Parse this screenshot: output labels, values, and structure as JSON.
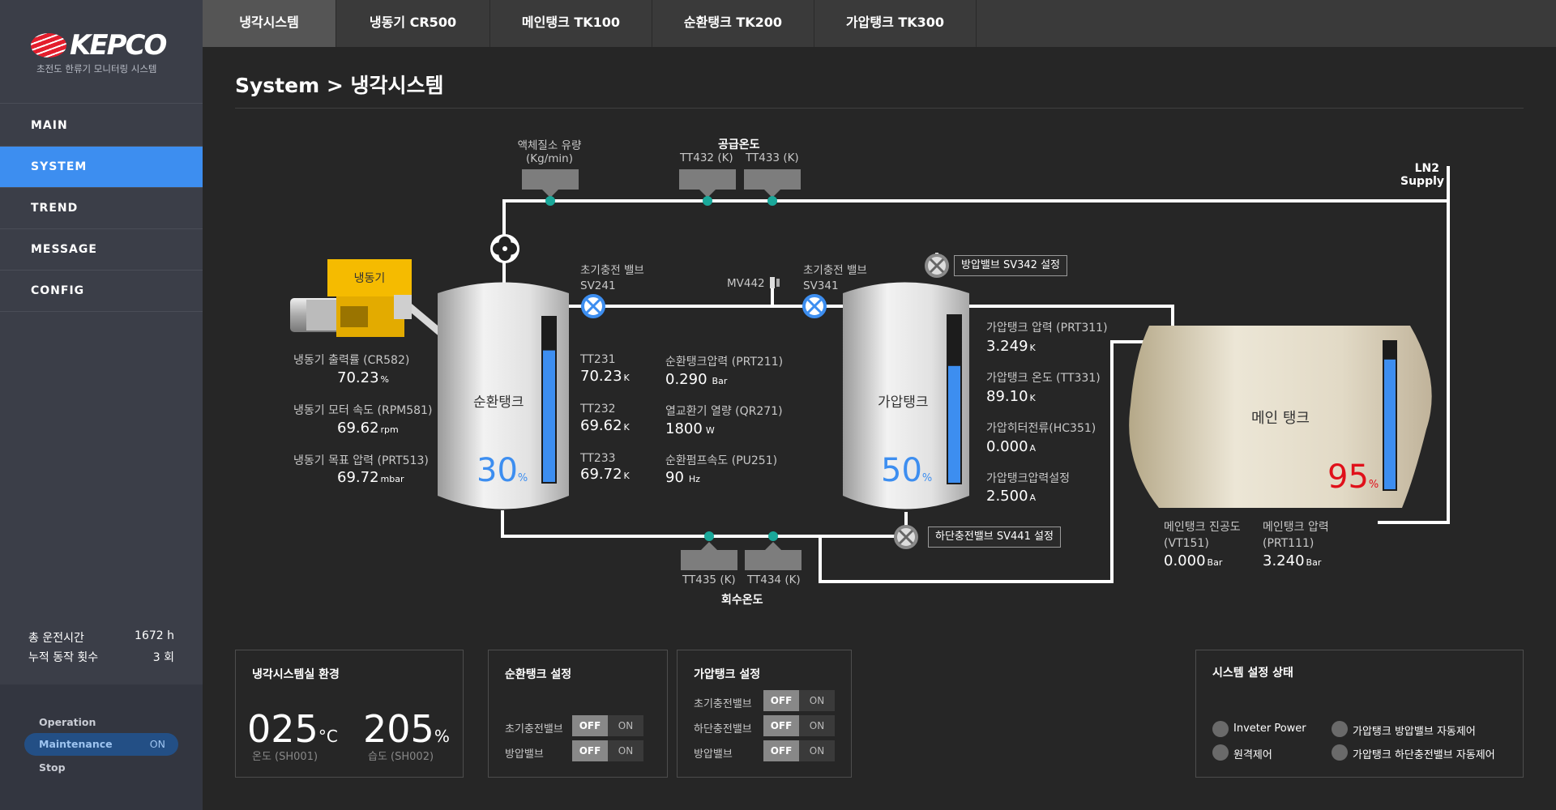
{
  "brand": {
    "name": "KEPCO",
    "subtitle": "초전도 한류기 모니터링 시스템"
  },
  "sidebar": {
    "menu": [
      {
        "label": "MAIN",
        "active": false
      },
      {
        "label": "SYSTEM",
        "active": true
      },
      {
        "label": "TREND",
        "active": false
      },
      {
        "label": "MESSAGE",
        "active": false
      },
      {
        "label": "CONFIG",
        "active": false
      }
    ],
    "runtime": {
      "label": "총 운전시간",
      "value": "1672 h"
    },
    "count": {
      "label": "누적 동작 횟수",
      "value": "3 회"
    },
    "modes": {
      "operation": "Operation",
      "maintenance": "Maintenance",
      "maintenance_state": "ON",
      "stop": "Stop"
    }
  },
  "tabs": [
    {
      "label": "냉각시스템",
      "active": true
    },
    {
      "label": "냉동기 CR500",
      "active": false
    },
    {
      "label": "메인탱크 TK100",
      "active": false
    },
    {
      "label": "순환탱크 TK200",
      "active": false
    },
    {
      "label": "가압탱크 TK300",
      "active": false
    }
  ],
  "page_title": "System > 냉각시스템",
  "diagram": {
    "ln2_flow_label": "액체질소 유량",
    "ln2_flow_unit": "(Kg/min)",
    "supply_temp_label": "공급온도",
    "tt432": "TT432 (K)",
    "tt433": "TT433 (K)",
    "ln2_supply_1": "LN2",
    "ln2_supply_2": "Supply",
    "freezer_label": "냉동기",
    "valve_sv241_label": "초기충전 밸브",
    "valve_sv241_tag": "SV241",
    "mv442": "MV442",
    "valve_sv341_label": "초기충전 밸브",
    "valve_sv341_tag": "SV341",
    "sv342_btn": "방압밸브 SV342 설정",
    "sv441_btn": "하단충전밸브 SV441 설정",
    "tt435": "TT435 (K)",
    "tt434": "TT434 (K)",
    "return_temp_label": "회수온도",
    "circ_tank": {
      "name": "순환탱크",
      "level": 30,
      "level_unit": "%"
    },
    "press_tank": {
      "name": "가압탱크",
      "level": 50,
      "level_unit": "%"
    },
    "main_tank": {
      "name": "메인 탱크",
      "level": 95,
      "level_unit": "%"
    },
    "freezer_readings": [
      {
        "label": "냉동기 출력률 (CR582)",
        "value": "70.23",
        "unit": "%"
      },
      {
        "label": "냉동기 모터 속도 (RPM581)",
        "value": "69.62",
        "unit": "rpm"
      },
      {
        "label": "냉동기 목표 압력 (PRT513)",
        "value": "69.72",
        "unit": "mbar"
      }
    ],
    "tt_readings": [
      {
        "label": "TT231",
        "value": "70.23",
        "unit": "K"
      },
      {
        "label": "TT232",
        "value": "69.62",
        "unit": "K"
      },
      {
        "label": "TT233",
        "value": "69.72",
        "unit": "K"
      }
    ],
    "circ_readings": [
      {
        "label": "순환탱크압력 (PRT211)",
        "value": "0.290",
        "unit": "Bar"
      },
      {
        "label": "열교환기 열량 (QR271)",
        "value": "1800",
        "unit": "W"
      },
      {
        "label": "순환펌프속도 (PU251)",
        "value": "90",
        "unit": "Hz"
      }
    ],
    "press_readings": [
      {
        "label": "가압탱크 압력 (PRT311)",
        "value": "3.249",
        "unit": "K"
      },
      {
        "label": "가압탱크 온도 (TT331)",
        "value": "89.10",
        "unit": "K"
      },
      {
        "label": "가압히터전류(HC351)",
        "value": "0.000",
        "unit": "A"
      },
      {
        "label": "가압탱크압력설정",
        "value": "2.500",
        "unit": "A"
      }
    ],
    "main_readings": [
      {
        "label1": "메인탱크 진공도",
        "label2": "(VT151)",
        "value": "0.000",
        "unit": "Bar"
      },
      {
        "label1": "메인탱크 압력",
        "label2": "(PRT111)",
        "value": "3.240",
        "unit": "Bar"
      }
    ]
  },
  "env_panel": {
    "title": "냉각시스템실 환경",
    "temp": {
      "value": "025",
      "unit": "°C",
      "label": "온도 (SH001)"
    },
    "humid": {
      "value": "205",
      "unit": "%",
      "label": "습도 (SH002)"
    }
  },
  "circ_panel": {
    "title": "순환탱크 설정",
    "rows": [
      {
        "label": "초기충전밸브",
        "off": "OFF",
        "on": "ON"
      },
      {
        "label": "방압밸브",
        "off": "OFF",
        "on": "ON"
      }
    ]
  },
  "press_panel": {
    "title": "가압탱크 설정",
    "rows": [
      {
        "label": "초기충전밸브",
        "off": "OFF",
        "on": "ON"
      },
      {
        "label": "하단충전밸브",
        "off": "OFF",
        "on": "ON"
      },
      {
        "label": "방압밸브",
        "off": "OFF",
        "on": "ON"
      }
    ]
  },
  "status_panel": {
    "title": "시스템 설정 상태",
    "items": [
      "Inveter Power",
      "원격제어",
      "가압탱크 방압밸브 자동제어",
      "가압탱크 하단충전밸브 자동제어"
    ]
  },
  "colors": {
    "accent": "#3d8ef0",
    "level_fill": "#3d8ef0",
    "teal": "#1aa89a",
    "alarm": "#e0101a",
    "freezer": "#f0b400"
  }
}
